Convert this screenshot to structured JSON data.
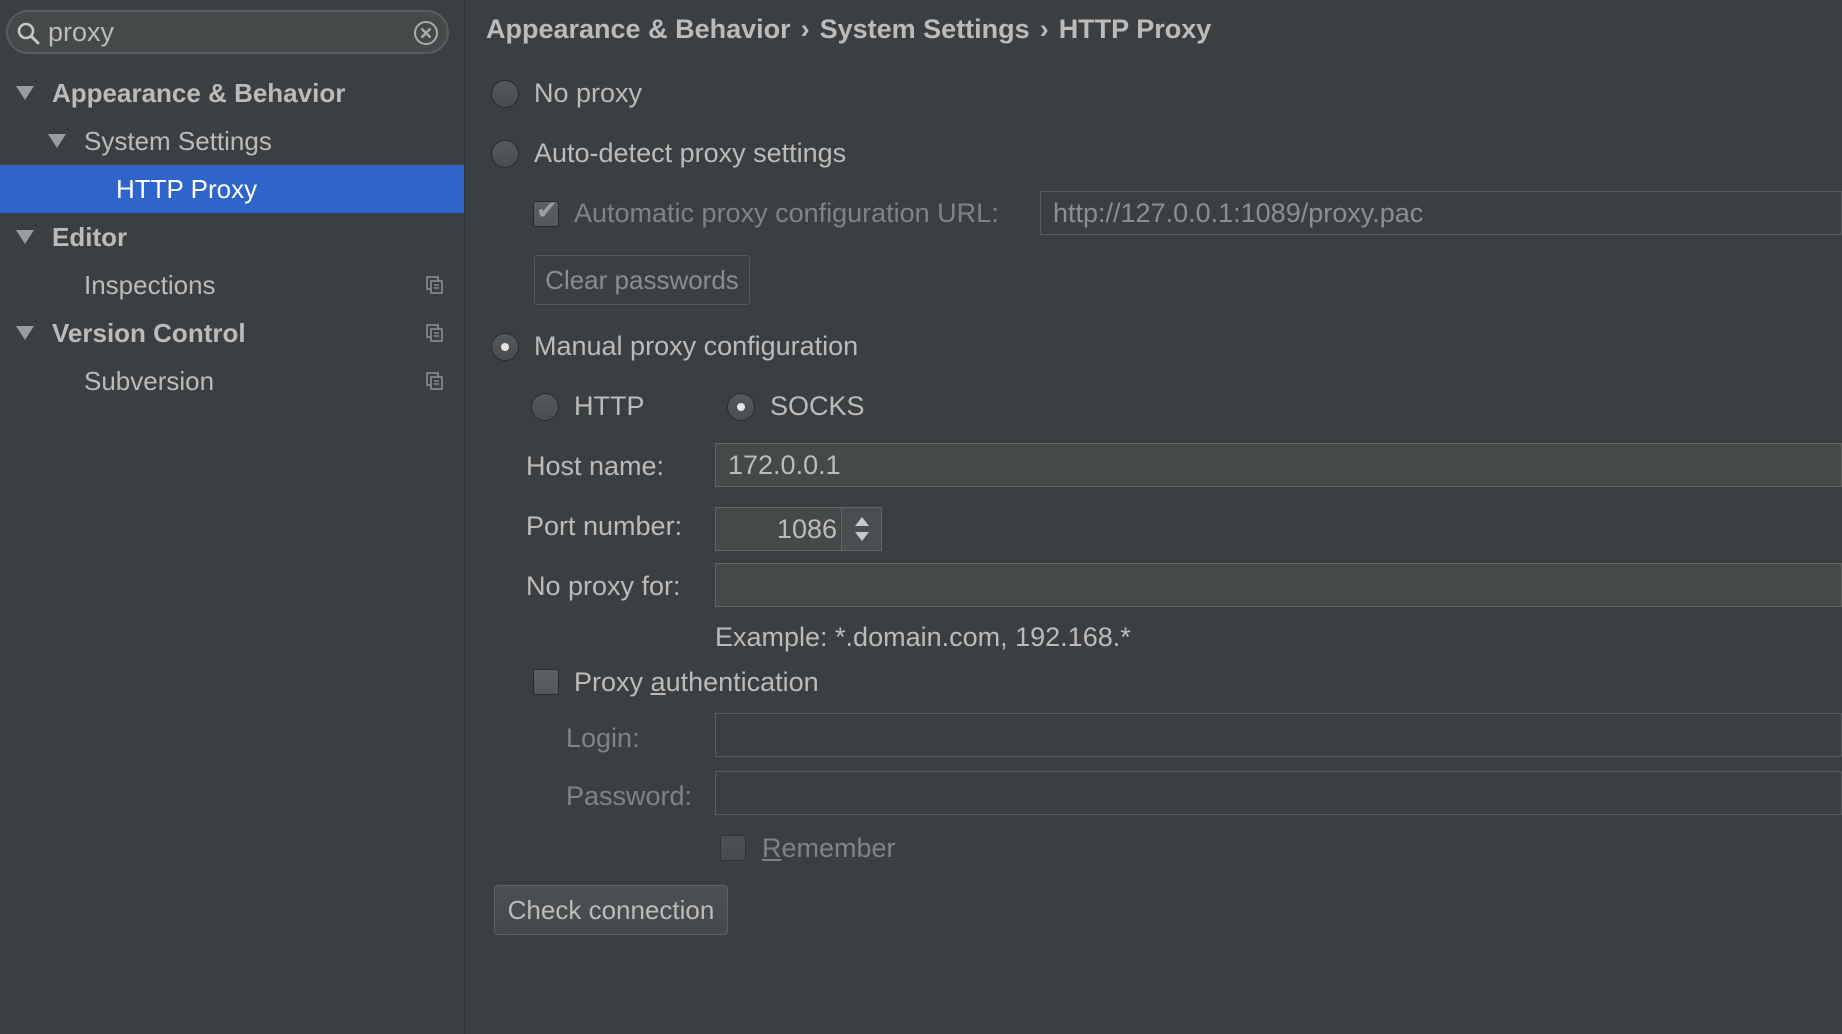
{
  "search": {
    "value": "proxy"
  },
  "tree": [
    {
      "label": "Appearance & Behavior",
      "bold": true
    },
    {
      "label": "System Settings",
      "bold": false
    },
    {
      "label": "HTTP Proxy",
      "bold": false,
      "selected": true
    },
    {
      "label": "Editor",
      "bold": true
    },
    {
      "label": "Inspections",
      "bold": false
    },
    {
      "label": "Version Control",
      "bold": true
    },
    {
      "label": "Subversion",
      "bold": false
    }
  ],
  "breadcrumb": [
    "Appearance & Behavior",
    "System Settings",
    "HTTP Proxy"
  ],
  "breadcrumb_sep": "›",
  "proxy": {
    "no_proxy_label": "No proxy",
    "auto_detect_label": "Auto-detect proxy settings",
    "auto_config_url_label": "Automatic proxy configuration URL:",
    "auto_config_url_value": "http://127.0.0.1:1089/proxy.pac",
    "clear_passwords_label": "Clear passwords",
    "manual_label": "Manual proxy configuration",
    "http_label": "HTTP",
    "socks_label": "SOCKS",
    "host_label": "Host name:",
    "host_value": "172.0.0.1",
    "port_label": "Port number:",
    "port_value": "1086",
    "no_proxy_for_label": "No proxy for:",
    "no_proxy_for_value": "",
    "example_text": "Example: *.domain.com, 192.168.*",
    "auth_label_pre": "Proxy ",
    "auth_label_mnemonic": "a",
    "auth_label_post": "uthentication",
    "login_label": "Login:",
    "password_label": "Password:",
    "remember_mnemonic": "R",
    "remember_rest": "emember",
    "check_connection_label": "Check connection"
  },
  "state": {
    "mode": "manual",
    "protocol": "SOCKS",
    "auto_config_url_checked": true,
    "proxy_auth_checked": false,
    "remember_checked": false
  },
  "colors": {
    "background": "#3c3f41",
    "selection": "#2f65ca",
    "text": "#bbbbbb",
    "disabled_text": "#808386"
  }
}
